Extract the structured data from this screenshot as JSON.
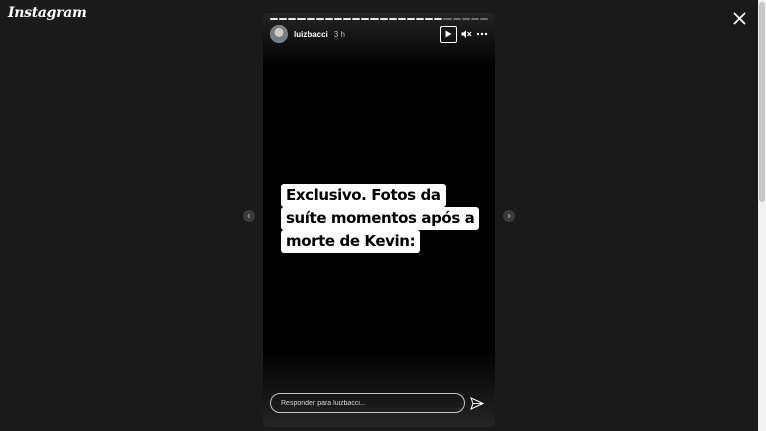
{
  "app": {
    "logo_text": "Instagram"
  },
  "story": {
    "username": "luizbacci",
    "time_ago": "3 h",
    "segments_total": 24,
    "segments_done": 19,
    "text_lines": [
      "Exclusivo. Fotos da",
      "suíte momentos após a",
      "morte de Kevin:"
    ],
    "reply_placeholder": "Responder para luizbacci..."
  },
  "icons": {
    "close": "close-icon",
    "play": "play-icon",
    "mute": "speaker-muted-icon",
    "more": "more-options-icon",
    "send": "paper-plane-icon",
    "prev": "chevron-left-icon",
    "next": "chevron-right-icon"
  },
  "colors": {
    "page_bg": "#1a1a1a",
    "story_bg": "#000000",
    "text_bg": "#ffffff",
    "text_fg": "#000000"
  }
}
